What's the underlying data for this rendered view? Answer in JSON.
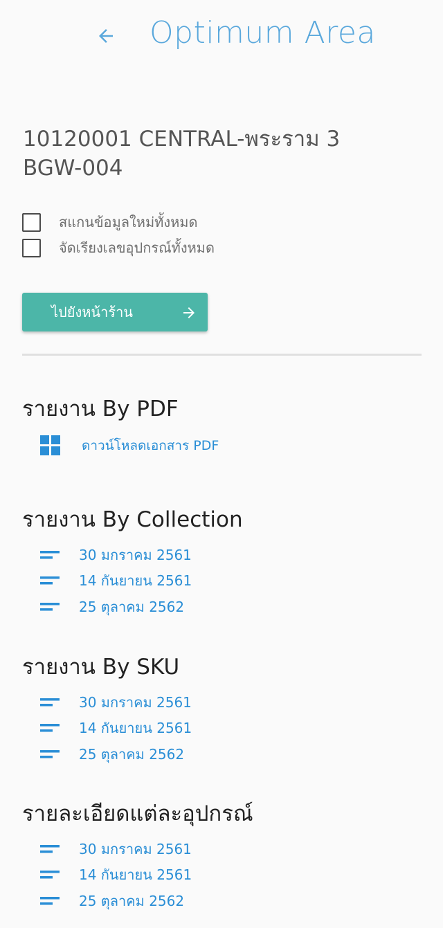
{
  "header": {
    "title": "Optimum Area",
    "back_icon": "arrow-left-icon",
    "accent_color": "#5aa8dc"
  },
  "branch": {
    "line1": "10120001 CENTRAL-พระราม 3",
    "line2": "BGW-004"
  },
  "options": {
    "rescan_all": {
      "label": "สแกนข้อมูลใหม่ทั้งหมด",
      "checked": false
    },
    "sort_all": {
      "label": "จัดเรียงเลขอุปกรณ์ทั้งหมด",
      "checked": false
    }
  },
  "go_button": {
    "label": "ไปยังหน้าร้าน",
    "icon": "arrow-right-icon",
    "color": "#4cb6a8"
  },
  "report_pdf": {
    "title": "รายงาน By PDF",
    "link_label": "ดาวน์โหลดเอกสาร PDF",
    "icon": "grid-icon"
  },
  "report_collection": {
    "title": "รายงาน By Collection",
    "items": [
      {
        "label": "30 มกราคม 2561"
      },
      {
        "label": "14 กันยายน 2561"
      },
      {
        "label": "25 ตุลาคม 2562"
      }
    ]
  },
  "report_sku": {
    "title": "รายงาน By SKU",
    "items": [
      {
        "label": "30 มกราคม 2561"
      },
      {
        "label": "14 กันยายน 2561"
      },
      {
        "label": "25 ตุลาคม 2562"
      }
    ]
  },
  "report_device": {
    "title": "รายละเอียดแต่ละอุปกรณ์",
    "items": [
      {
        "label": "30 มกราคม 2561"
      },
      {
        "label": "14 กันยายน 2561"
      },
      {
        "label": "25 ตุลาคม 2562"
      }
    ]
  },
  "link_color": "#2a8ed6"
}
